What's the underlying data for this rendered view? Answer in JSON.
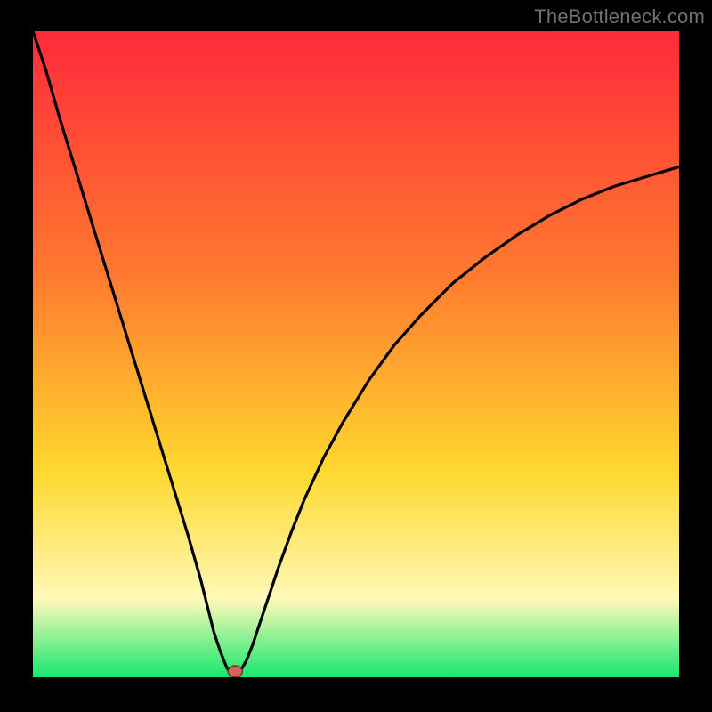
{
  "attribution": "TheBottleneck.com",
  "colors": {
    "frame": "#000000",
    "grad_top": "#ff2a3a",
    "grad_mid1": "#ff7a2f",
    "grad_mid2": "#ffd82d",
    "grad_mid3": "#fff8b8",
    "grad_bottom": "#17e86f",
    "curve": "#000000",
    "dot_fill": "#d2655a",
    "dot_stroke": "#7a2f27"
  },
  "chart_data": {
    "type": "line",
    "title": "",
    "xlabel": "",
    "ylabel": "",
    "xlim": [
      0,
      100
    ],
    "ylim": [
      0,
      100
    ],
    "series": [
      {
        "name": "bottleneck-curve",
        "x": [
          0,
          2,
          4,
          6,
          8,
          10,
          12,
          14,
          16,
          18,
          20,
          22,
          24,
          26,
          27,
          28,
          29,
          30,
          30.5,
          31,
          31.5,
          32,
          33,
          34,
          35,
          36,
          38,
          40,
          42,
          45,
          48,
          52,
          56,
          60,
          65,
          70,
          75,
          80,
          85,
          90,
          95,
          100
        ],
        "y": [
          100,
          94,
          87,
          80.5,
          74,
          67.5,
          61,
          54.5,
          48,
          41.5,
          35,
          28.5,
          22,
          15,
          11,
          7,
          4,
          1.5,
          0.7,
          0.4,
          0.4,
          0.8,
          2.5,
          5,
          8,
          11,
          17,
          22.5,
          27.5,
          34,
          39.5,
          46,
          51.5,
          56,
          61,
          65,
          68.5,
          71.5,
          74,
          76,
          77.5,
          79
        ]
      }
    ],
    "min_marker": {
      "x": 31.3,
      "y": 0.9
    },
    "annotations": []
  }
}
